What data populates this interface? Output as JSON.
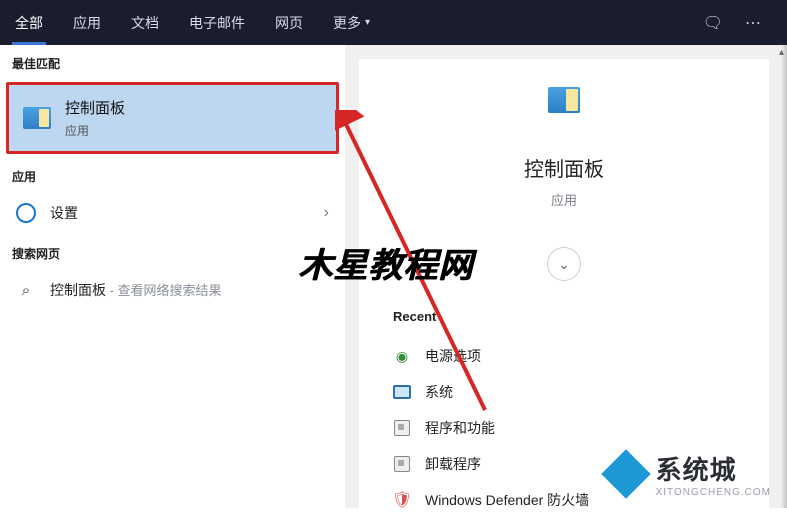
{
  "tabs": {
    "all": "全部",
    "app": "应用",
    "doc": "文档",
    "mail": "电子邮件",
    "web": "网页",
    "more": "更多"
  },
  "sections": {
    "best": "最佳匹配",
    "apps": "应用",
    "web": "搜索网页",
    "recent": "Recent"
  },
  "best_match": {
    "title": "控制面板",
    "sub": "应用"
  },
  "apps_list": {
    "settings": "设置"
  },
  "web_search": {
    "term": "控制面板",
    "hint": " - 查看网络搜索结果"
  },
  "preview": {
    "title": "控制面板",
    "sub": "应用"
  },
  "recent": {
    "items": [
      {
        "label": "电源选项",
        "icon": "power"
      },
      {
        "label": "系统",
        "icon": "sys"
      },
      {
        "label": "程序和功能",
        "icon": "prog"
      },
      {
        "label": "卸载程序",
        "icon": "prog"
      },
      {
        "label": "Windows Defender 防火墙",
        "icon": "shield"
      }
    ]
  },
  "watermarks": {
    "center": "木星教程网",
    "brand_cn": "系统城",
    "brand_en": "XITONGCHENG.COM"
  }
}
